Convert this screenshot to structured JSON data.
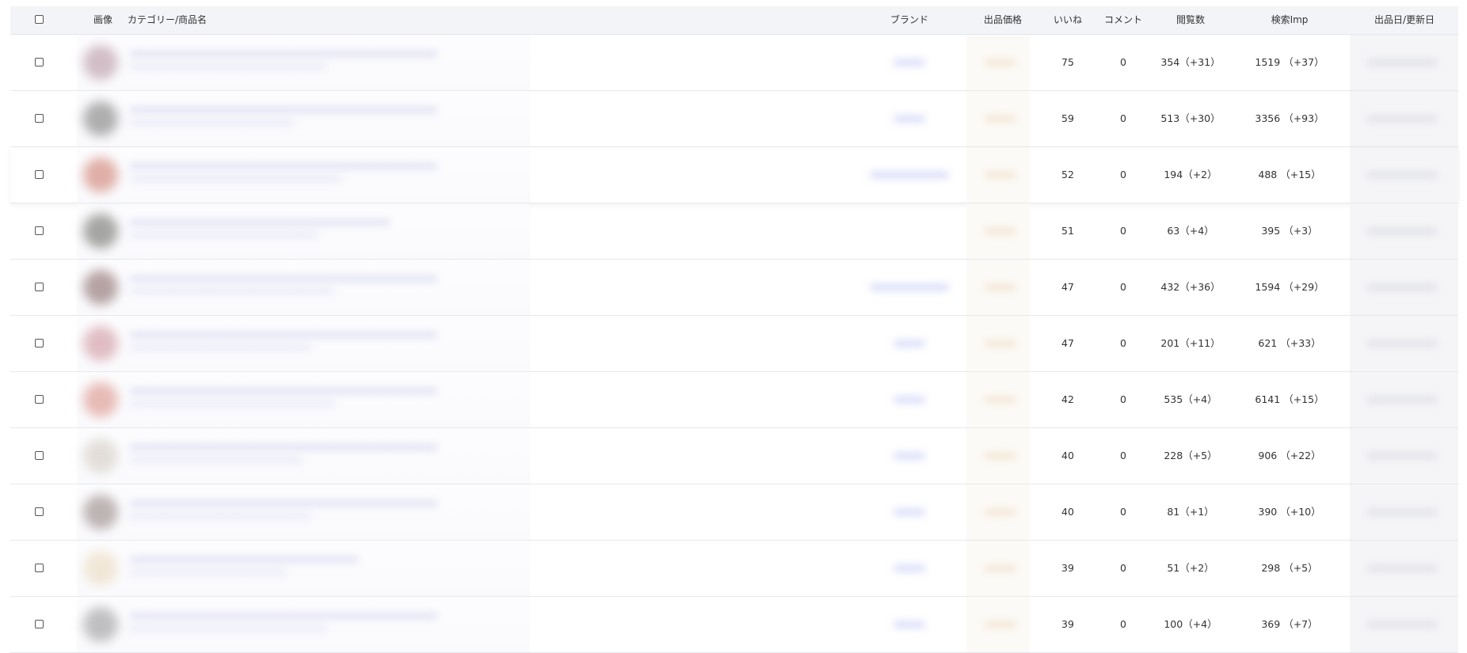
{
  "headers": {
    "image": "画像",
    "category_name": "カテゴリー/商品名",
    "brand": "ブランド",
    "price": "出品価格",
    "likes": "いいね",
    "comments": "コメント",
    "views": "閲覧数",
    "search_imp": "検索Imp",
    "listed_updated": "出品日/更新日"
  },
  "rows": [
    {
      "likes": "75",
      "comments": "0",
      "views": "354（+31）",
      "search_imp": "1519 （+37）"
    },
    {
      "likes": "59",
      "comments": "0",
      "views": "513（+30）",
      "search_imp": "3356 （+93）"
    },
    {
      "likes": "52",
      "comments": "0",
      "views": "194（+2）",
      "search_imp": "488 （+15）"
    },
    {
      "likes": "51",
      "comments": "0",
      "views": "63（+4）",
      "search_imp": "395 （+3）"
    },
    {
      "likes": "47",
      "comments": "0",
      "views": "432（+36）",
      "search_imp": "1594 （+29）"
    },
    {
      "likes": "47",
      "comments": "0",
      "views": "201（+11）",
      "search_imp": "621 （+33）"
    },
    {
      "likes": "42",
      "comments": "0",
      "views": "535（+4）",
      "search_imp": "6141 （+15）"
    },
    {
      "likes": "40",
      "comments": "0",
      "views": "228（+5）",
      "search_imp": "906 （+22）"
    },
    {
      "likes": "40",
      "comments": "0",
      "views": "81（+1）",
      "search_imp": "390 （+10）"
    },
    {
      "likes": "39",
      "comments": "0",
      "views": "51（+2）",
      "search_imp": "298 （+5）"
    },
    {
      "likes": "39",
      "comments": "0",
      "views": "100（+4）",
      "search_imp": "369 （+7）"
    }
  ],
  "colors": {
    "header_bg": "#f3f4f8",
    "row_border": "#e6e8ed",
    "blur_link": "#b9c0f3"
  }
}
